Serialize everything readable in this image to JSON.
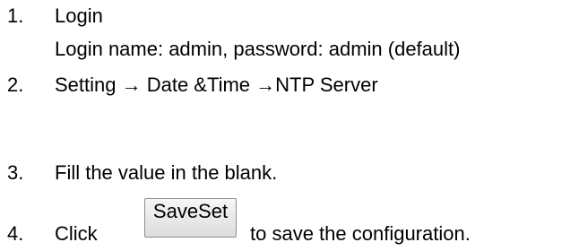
{
  "steps": [
    {
      "number": "1.",
      "text": "Login",
      "detail": "Login name: admin, password: admin (default)"
    },
    {
      "number": "2.",
      "text": "Setting → Date &Time →NTP Server"
    },
    {
      "number": "3.",
      "text": "Fill the value in the blank."
    },
    {
      "number": "4.",
      "text_before": "Click",
      "button_label": "SaveSet",
      "text_after": "to save the configuration."
    }
  ]
}
